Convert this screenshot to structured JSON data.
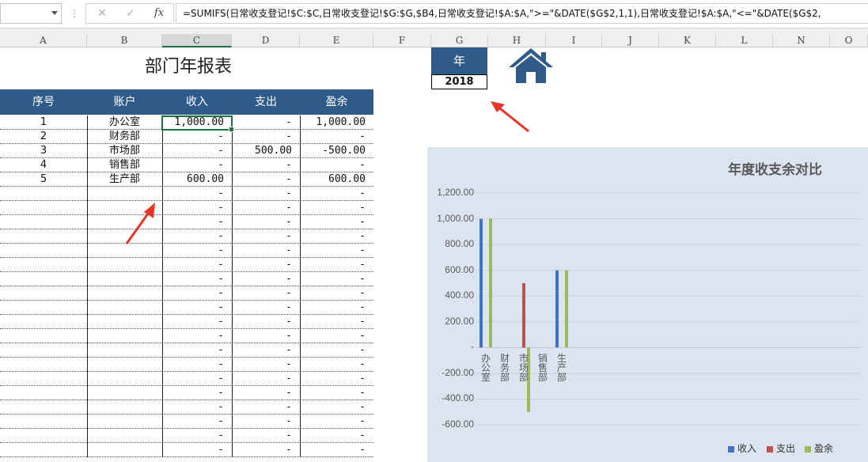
{
  "formula_bar": {
    "name_box": "",
    "cancel_icon": "✕",
    "enter_icon": "✓",
    "fx_label": "fx",
    "formula": "=SUMIFS(日常收支登记!$C:$C,日常收支登记!$G:$G,$B4,日常收支登记!$A:$A,\">=\"&DATE($G$2,1,1),日常收支登记!$A:$A,\"<=\"&DATE($G$2,"
  },
  "columns": [
    "A",
    "B",
    "C",
    "D",
    "E",
    "F",
    "G",
    "H",
    "I",
    "J",
    "K",
    "L",
    "N",
    "O"
  ],
  "sheet": {
    "title": "部门年报表",
    "year_label": "年",
    "year_value": "2018",
    "headers": [
      "序号",
      "账户",
      "收入",
      "支出",
      "盈余"
    ],
    "rows": [
      {
        "seq": "1",
        "account": "办公室",
        "income": "1,000.00",
        "expense": "-",
        "surplus": "1,000.00"
      },
      {
        "seq": "2",
        "account": "财务部",
        "income": "-",
        "expense": "-",
        "surplus": "-"
      },
      {
        "seq": "3",
        "account": "市场部",
        "income": "-",
        "expense": "500.00",
        "surplus": "-500.00"
      },
      {
        "seq": "4",
        "account": "销售部",
        "income": "-",
        "expense": "-",
        "surplus": "-"
      },
      {
        "seq": "5",
        "account": "生产部",
        "income": "600.00",
        "expense": "-",
        "surplus": "600.00"
      },
      {
        "seq": "",
        "account": "",
        "income": "-",
        "expense": "-",
        "surplus": "-"
      },
      {
        "seq": "",
        "account": "",
        "income": "-",
        "expense": "-",
        "surplus": "-"
      },
      {
        "seq": "",
        "account": "",
        "income": "-",
        "expense": "-",
        "surplus": "-"
      },
      {
        "seq": "",
        "account": "",
        "income": "-",
        "expense": "-",
        "surplus": "-"
      },
      {
        "seq": "",
        "account": "",
        "income": "-",
        "expense": "-",
        "surplus": "-"
      },
      {
        "seq": "",
        "account": "",
        "income": "-",
        "expense": "-",
        "surplus": "-"
      },
      {
        "seq": "",
        "account": "",
        "income": "-",
        "expense": "-",
        "surplus": "-"
      },
      {
        "seq": "",
        "account": "",
        "income": "-",
        "expense": "-",
        "surplus": "-"
      },
      {
        "seq": "",
        "account": "",
        "income": "-",
        "expense": "-",
        "surplus": "-"
      },
      {
        "seq": "",
        "account": "",
        "income": "-",
        "expense": "-",
        "surplus": "-"
      },
      {
        "seq": "",
        "account": "",
        "income": "-",
        "expense": "-",
        "surplus": "-"
      },
      {
        "seq": "",
        "account": "",
        "income": "-",
        "expense": "-",
        "surplus": "-"
      },
      {
        "seq": "",
        "account": "",
        "income": "-",
        "expense": "-",
        "surplus": "-"
      },
      {
        "seq": "",
        "account": "",
        "income": "-",
        "expense": "-",
        "surplus": "-"
      },
      {
        "seq": "",
        "account": "",
        "income": "-",
        "expense": "-",
        "surplus": "-"
      },
      {
        "seq": "",
        "account": "",
        "income": "-",
        "expense": "-",
        "surplus": "-"
      },
      {
        "seq": "",
        "account": "",
        "income": "-",
        "expense": "-",
        "surplus": "-"
      },
      {
        "seq": "",
        "account": "",
        "income": "-",
        "expense": "-",
        "surplus": "-"
      },
      {
        "seq": "",
        "account": "",
        "income": "-",
        "expense": "-",
        "surplus": "-"
      }
    ]
  },
  "icons": {
    "home": "home-icon",
    "arrow": "red-arrow-icon"
  },
  "colors": {
    "header_blue": "#2f5b8b",
    "income": "#4472c4",
    "expense": "#c0504d",
    "surplus": "#9bbb59",
    "chart_bg": "#dbe4ef",
    "selection": "#1f7145",
    "arrow": "#e8352c"
  },
  "chart_data": {
    "type": "bar",
    "title": "年度收支余对比",
    "categories": [
      "办公室",
      "财务部",
      "市场部",
      "销售部",
      "生产部"
    ],
    "series": [
      {
        "name": "收入",
        "values": [
          1000,
          0,
          0,
          0,
          600
        ]
      },
      {
        "name": "支出",
        "values": [
          0,
          0,
          500,
          0,
          0
        ]
      },
      {
        "name": "盈余",
        "values": [
          1000,
          0,
          -500,
          0,
          600
        ]
      }
    ],
    "ylim": [
      -600,
      1200
    ],
    "yticks": [
      "1,200.00",
      "1,000.00",
      "800.00",
      "600.00",
      "400.00",
      "200.00",
      "-",
      "-200.00",
      "-400.00",
      "-600.00"
    ],
    "legend": "bottom-right",
    "grid": true
  }
}
